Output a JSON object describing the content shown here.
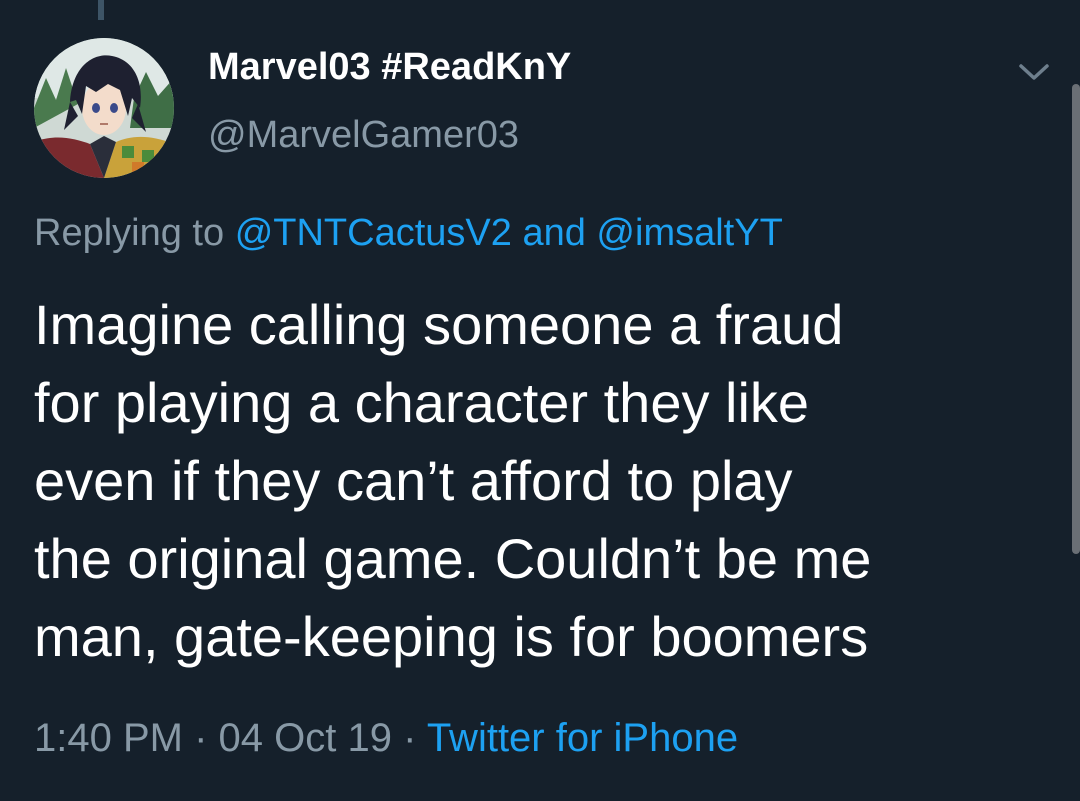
{
  "tweet": {
    "display_name": "Marvel03 #ReadKnY",
    "handle": "@MarvelGamer03",
    "reply": {
      "prefix": "Replying to",
      "mention1": "@TNTCactusV2",
      "joiner": "and",
      "mention2": "@imsaltYT"
    },
    "text": "Imagine calling someone a fraud\nfor playing a character they like\neven if they can’t afford to play\nthe original game. Couldn’t be me\nman, gate-keeping is for boomers",
    "time": "1:40 PM",
    "separator": "·",
    "date": "04 Oct 19",
    "source": "Twitter for iPhone"
  },
  "icons": {
    "avatar": "anime-character-avatar",
    "menu": "chevron-down-icon"
  },
  "colors": {
    "background": "#15202b",
    "text_primary": "#ffffff",
    "text_secondary": "#8899a6",
    "accent": "#1da1f2"
  }
}
